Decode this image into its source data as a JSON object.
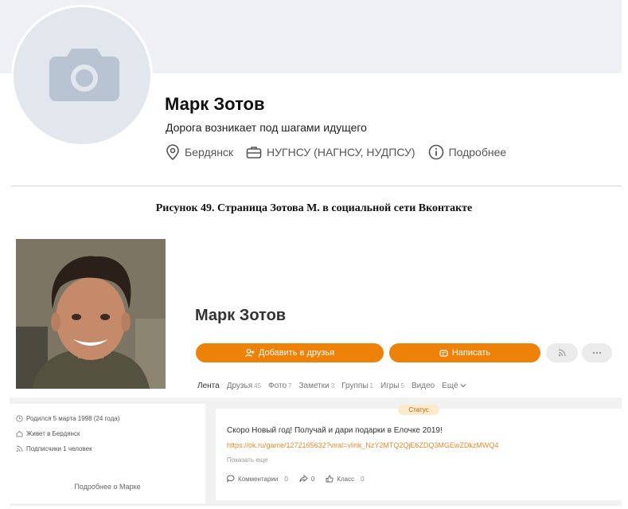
{
  "vk": {
    "name": "Марк Зотов",
    "status": "Дорога возникает под шагами идущего",
    "city": "Бердянск",
    "university": "НУГНСУ (НАГНСУ, НУДПСУ)",
    "details": "Подробнее"
  },
  "caption": "Рисунок 49. Страница Зотова М. в социальной сети Вконтакте",
  "ok": {
    "name": "Марк Зотов",
    "buttons": {
      "add_friend": "Добавить в друзья",
      "write": "Написать"
    },
    "tabs": [
      {
        "label": "Лента",
        "count": ""
      },
      {
        "label": "Друзья",
        "count": "45"
      },
      {
        "label": "Фото",
        "count": "7"
      },
      {
        "label": "Заметки",
        "count": "3"
      },
      {
        "label": "Группы",
        "count": "1"
      },
      {
        "label": "Игры",
        "count": "5"
      },
      {
        "label": "Видео",
        "count": ""
      },
      {
        "label": "Ещё",
        "count": ""
      }
    ],
    "info": {
      "born": "Родился 5 марта 1998 (24 года)",
      "lives": "Живет в Бердянск",
      "subscribers": "Подписчики 1 человек",
      "more": "Подробнее о Марке"
    },
    "post": {
      "badge": "Статус",
      "title": "Скоро Новый год! Получай и дари подарки в Елочке 2019!",
      "link": "https://ok.ru/game/1272165632?viral=vlink_NzY2MTQ2QjE6ZDQ3MGEwZDkzMWQ4",
      "show_more": "Показать еще",
      "comments_label": "Комментарии",
      "comments_count": "0",
      "shares_count": "0",
      "likes_label": "Класс",
      "likes_count": "0"
    }
  },
  "colors": {
    "ok_orange": "#ee8208",
    "vk_cover": "#eef0f5"
  }
}
